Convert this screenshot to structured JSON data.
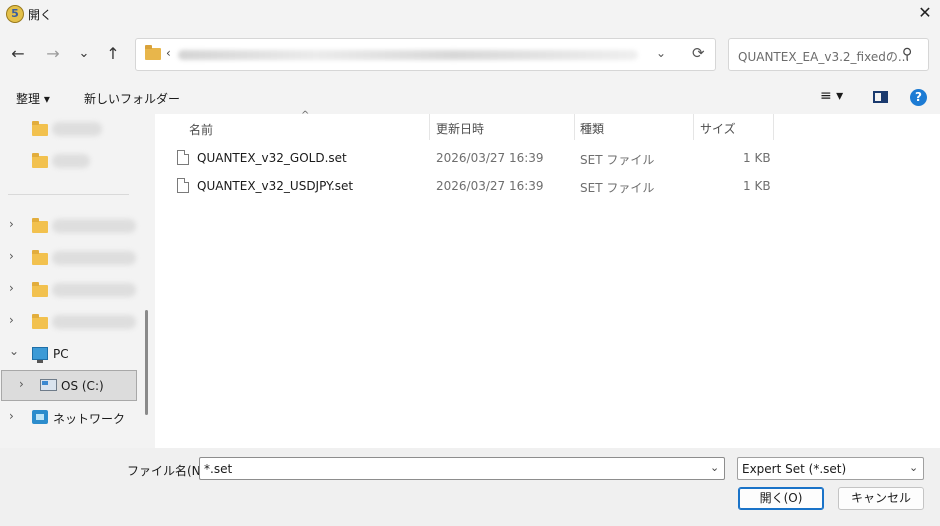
{
  "window": {
    "title": "開く",
    "close_glyph": "✕"
  },
  "nav": {
    "back_glyph": "←",
    "forward_glyph": "→",
    "recent_glyph": "⌄",
    "up_glyph": "↑",
    "address_chevron": "‹",
    "address_dropdown_glyph": "⌄",
    "refresh_glyph": "⟳",
    "search_placeholder": "QUANTEX_EA_v3.2_fixedの...",
    "search_glyph": "⚲"
  },
  "toolbar": {
    "organize_label": "整理 ▾",
    "new_folder_label": "新しいフォルダー",
    "view_glyph": "≡ ▾",
    "help_glyph": "?"
  },
  "sidebar": {
    "pc_label": "PC",
    "drive_label": "OS (C:)",
    "network_label": "ネットワーク",
    "expand_glyph": "›",
    "expanded_glyph": "⌄"
  },
  "file_list": {
    "columns": [
      "名前",
      "更新日時",
      "種類",
      "サイズ"
    ],
    "sort_glyph": "^",
    "rows": [
      {
        "name": "QUANTEX_v32_GOLD.set",
        "modified": "2026/03/27 16:39",
        "type": "SET ファイル",
        "size": "1 KB"
      },
      {
        "name": "QUANTEX_v32_USDJPY.set",
        "modified": "2026/03/27 16:39",
        "type": "SET ファイル",
        "size": "1 KB"
      }
    ]
  },
  "footer": {
    "filename_label": "ファイル名(N):",
    "filename_value": "*.set",
    "filter_value": "Expert Set (*.set)",
    "dropdown_glyph": "⌄",
    "open_label": "開く(O)",
    "cancel_label": "キャンセル"
  }
}
